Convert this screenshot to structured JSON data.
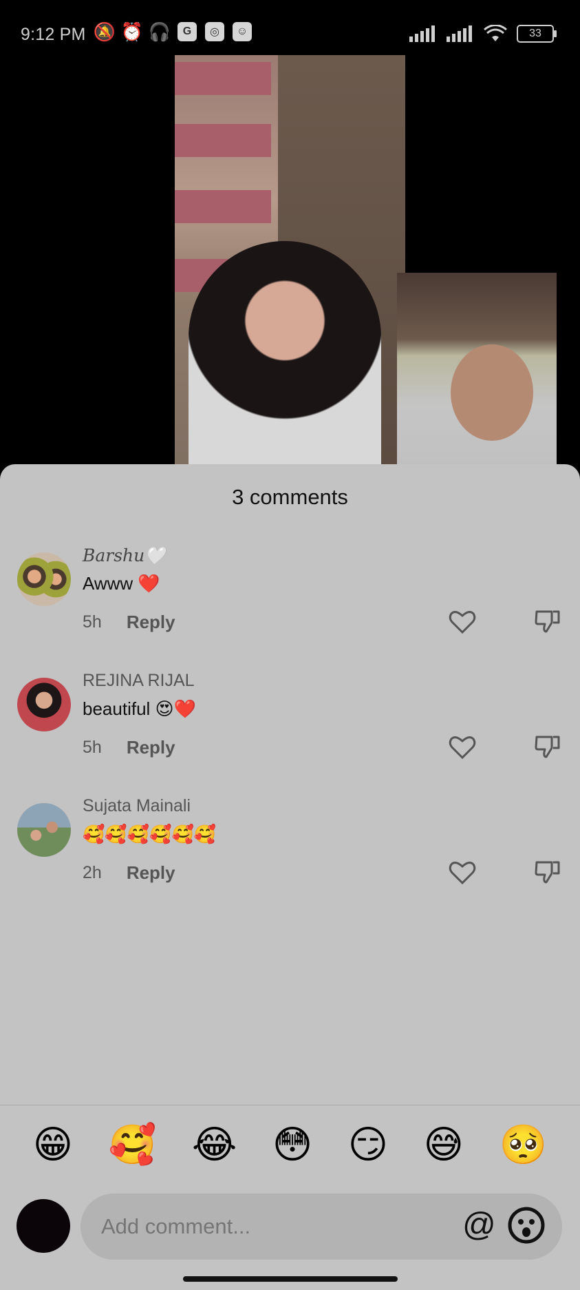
{
  "status_bar": {
    "time": "9:12 PM",
    "battery": "33"
  },
  "sheet": {
    "title": "3 comments"
  },
  "comments": [
    {
      "user": "Barshu🤍",
      "text": "Awww ❤️",
      "time": "5h",
      "reply_label": "Reply"
    },
    {
      "user": "REJINA RIJAL",
      "text": "beautiful 😍❤️",
      "time": "5h",
      "reply_label": "Reply"
    },
    {
      "user": "Sujata Mainali",
      "text": "🥰🥰🥰🥰🥰🥰",
      "time": "2h",
      "reply_label": "Reply"
    }
  ],
  "emoji_bar": [
    "😁",
    "🥰",
    "😂",
    "😳",
    "😏",
    "😅",
    "🥺"
  ],
  "composer": {
    "placeholder": "Add comment...",
    "mention_symbol": "@"
  }
}
